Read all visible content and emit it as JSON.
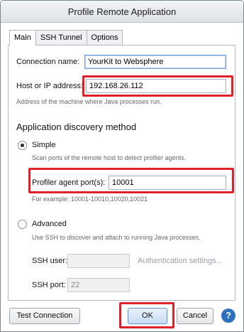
{
  "window": {
    "title": "Profile Remote Application"
  },
  "tabs": [
    {
      "label": "Main"
    },
    {
      "label": "SSH Tunnel"
    },
    {
      "label": "Options"
    }
  ],
  "main": {
    "connection_name_label": "Connection name:",
    "connection_name_value": "YourKit to Websphere",
    "host_label": "Host or IP address:",
    "host_value": "192.168.26.112",
    "host_hint": "Address of the machine where Java processes run.",
    "discovery_title": "Application discovery method",
    "simple_label": "Simple",
    "simple_hint": "Scan ports of the remote host to detect profiler agents.",
    "agent_port_label": "Profiler agent port(s):",
    "agent_port_value": "10001",
    "agent_port_hint": "For example: 10001-10010,10020,10021",
    "advanced_label": "Advanced",
    "advanced_hint": "Use SSH to discover and attach to running Java processes.",
    "ssh_user_label": "SSH user:",
    "ssh_user_value": "",
    "auth_settings_label": "Authentication settings...",
    "ssh_port_label": "SSH port:",
    "ssh_port_value": "22"
  },
  "footer": {
    "test_connection_label": "Test Connection",
    "ok_label": "OK",
    "cancel_label": "Cancel",
    "help_label": "?"
  },
  "colors": {
    "highlight": "#e0202a",
    "help_icon": "#2e6fbf"
  }
}
